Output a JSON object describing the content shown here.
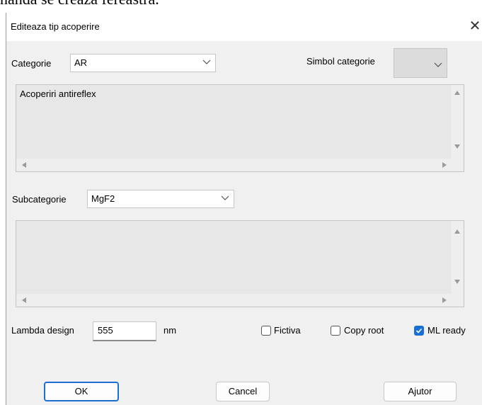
{
  "background_text": "nanda se creaza fereastra.",
  "dialog": {
    "title": "Editeaza tip acoperire",
    "close_glyph": "✕"
  },
  "categorie": {
    "label": "Categorie",
    "value": "AR",
    "simbol_label": "Simbol categorie",
    "description": "Acoperiri antireflex"
  },
  "subcategorie": {
    "label": "Subcategorie",
    "value": "MgF2",
    "description": ""
  },
  "lambda": {
    "label": "Lambda design",
    "value": "555",
    "unit": "nm"
  },
  "checkboxes": [
    {
      "label": "Fictiva",
      "checked": false
    },
    {
      "label": "Copy root",
      "checked": false
    },
    {
      "label": "ML ready",
      "checked": true
    }
  ],
  "buttons": {
    "ok": "OK",
    "cancel": "Cancel",
    "help": "Ajutor"
  },
  "colors": {
    "accent": "#1a6fd6",
    "dialog_bg": "#f0f0f0",
    "textarea_bg": "#e7e7e7"
  }
}
